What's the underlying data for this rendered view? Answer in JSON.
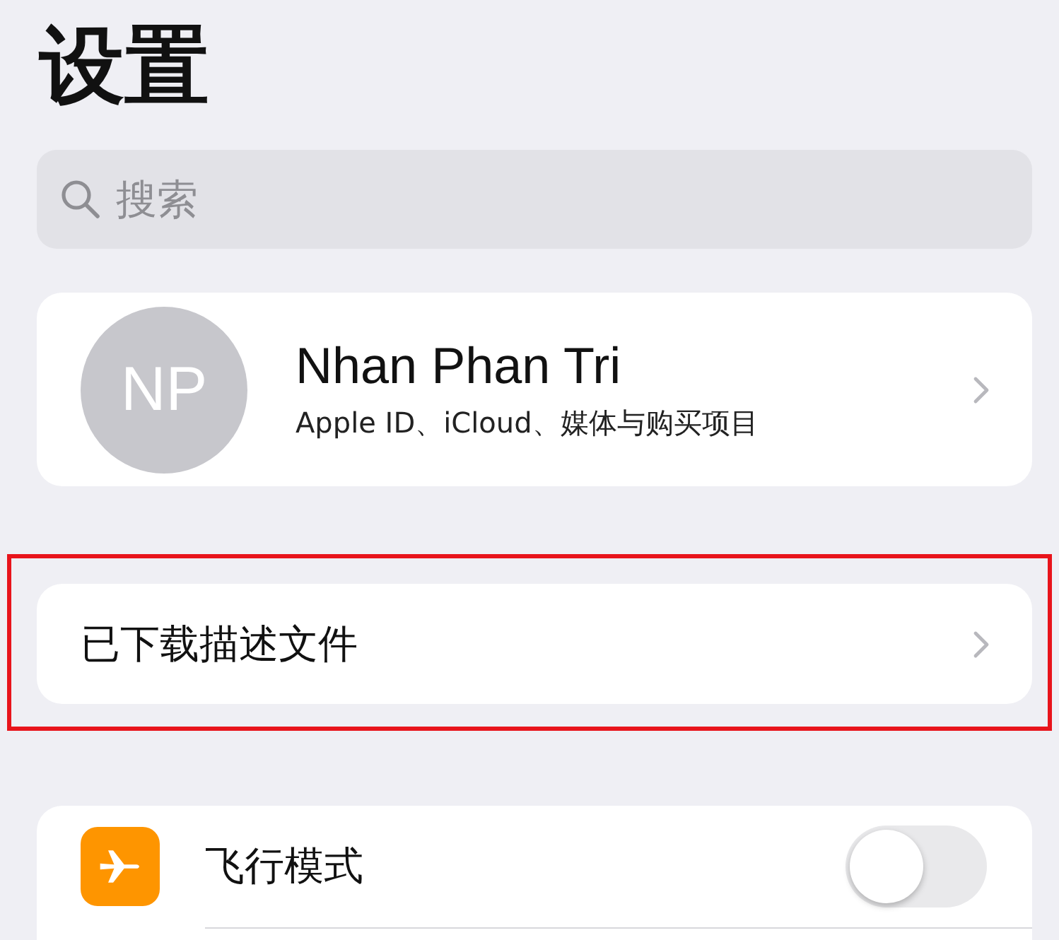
{
  "title": "设置",
  "search": {
    "placeholder": "搜索"
  },
  "profile": {
    "initials": "NP",
    "name": "Nhan Phan Tri",
    "subtitle": "Apple ID、iCloud、媒体与购买项目"
  },
  "profile_download": {
    "label": "已下载描述文件",
    "highlighted": true
  },
  "settings": [
    {
      "kind": "toggle",
      "label": "飞行模式",
      "on": false
    }
  ]
}
